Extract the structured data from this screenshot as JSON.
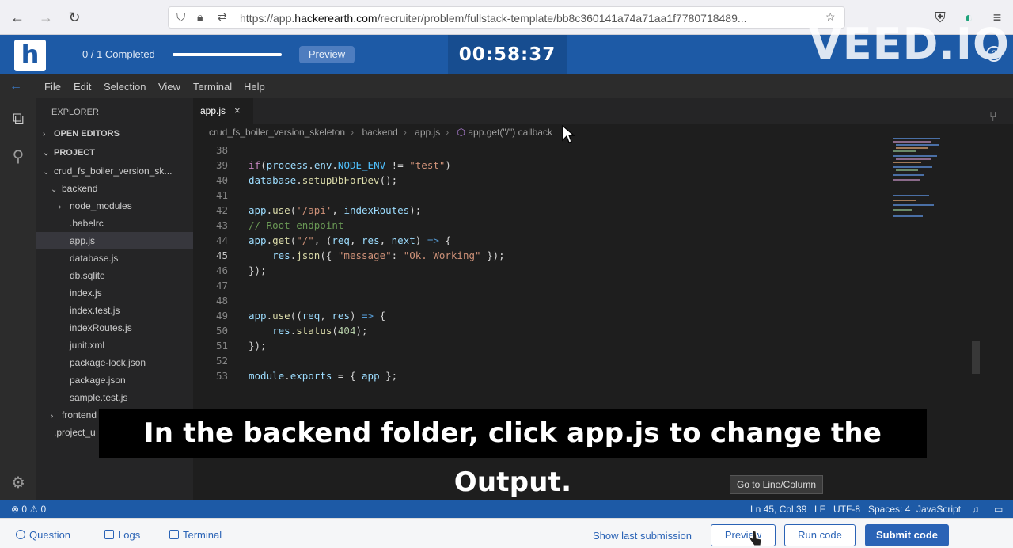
{
  "browser": {
    "url_prefix": "https://app.",
    "url_domain": "hackerearth.com",
    "url_path": "/recruiter/problem/fullstack-template/bb8c360141a74a71aa1f7780718489..."
  },
  "header": {
    "logo_text": "h",
    "progress_label": "0 / 1 Completed",
    "progress_fraction": 1.0,
    "preview_label": "Preview",
    "timer": "00:58:37",
    "watermark": "VEED.IO"
  },
  "menu": [
    "File",
    "Edit",
    "Selection",
    "View",
    "Terminal",
    "Help"
  ],
  "sidebar": {
    "title": "EXPLORER",
    "open_editors": "OPEN EDITORS",
    "project": "PROJECT",
    "tree": [
      {
        "label": "crud_fs_boiler_version_sk...",
        "chev": "⌄"
      },
      {
        "label": "backend",
        "chev": "⌄"
      },
      {
        "label": "node_modules",
        "chev": "›"
      },
      {
        "label": ".babelrc",
        "chev": ""
      },
      {
        "label": "app.js",
        "chev": ""
      },
      {
        "label": "database.js",
        "chev": ""
      },
      {
        "label": "db.sqlite",
        "chev": ""
      },
      {
        "label": "index.js",
        "chev": ""
      },
      {
        "label": "index.test.js",
        "chev": ""
      },
      {
        "label": "indexRoutes.js",
        "chev": ""
      },
      {
        "label": "junit.xml",
        "chev": ""
      },
      {
        "label": "package-lock.json",
        "chev": ""
      },
      {
        "label": "package.json",
        "chev": ""
      },
      {
        "label": "sample.test.js",
        "chev": ""
      },
      {
        "label": "frontend",
        "chev": "›"
      },
      {
        "label": ".project_u",
        "chev": ""
      }
    ]
  },
  "editor": {
    "tab_label": "app.js",
    "tab_close": "×",
    "breadcrumb": [
      "crud_fs_boiler_version_skeleton",
      "backend",
      "app.js",
      "app.get(\"/\") callback"
    ],
    "line_numbers": [
      "38",
      "39",
      "40",
      "41",
      "42",
      "43",
      "44",
      "45",
      "46",
      "47",
      "48",
      "49",
      "50",
      "51",
      "52",
      "53"
    ],
    "current_line": "45",
    "tooltip": "Go to Line/Column"
  },
  "subtitle": "In the backend folder, click app.js to change the Output.",
  "status_bar": {
    "problems": "⊗ 0 ⚠ 0",
    "position": "Ln 45, Col 39",
    "eol": "LF",
    "encoding": "UTF-8",
    "spaces": "Spaces: 4",
    "language": "JavaScript"
  },
  "bottom_bar": {
    "question": "Question",
    "logs": "Logs",
    "terminal": "Terminal",
    "show_last": "Show last submission",
    "preview": "Preview",
    "run": "Run code",
    "submit": "Submit code"
  }
}
